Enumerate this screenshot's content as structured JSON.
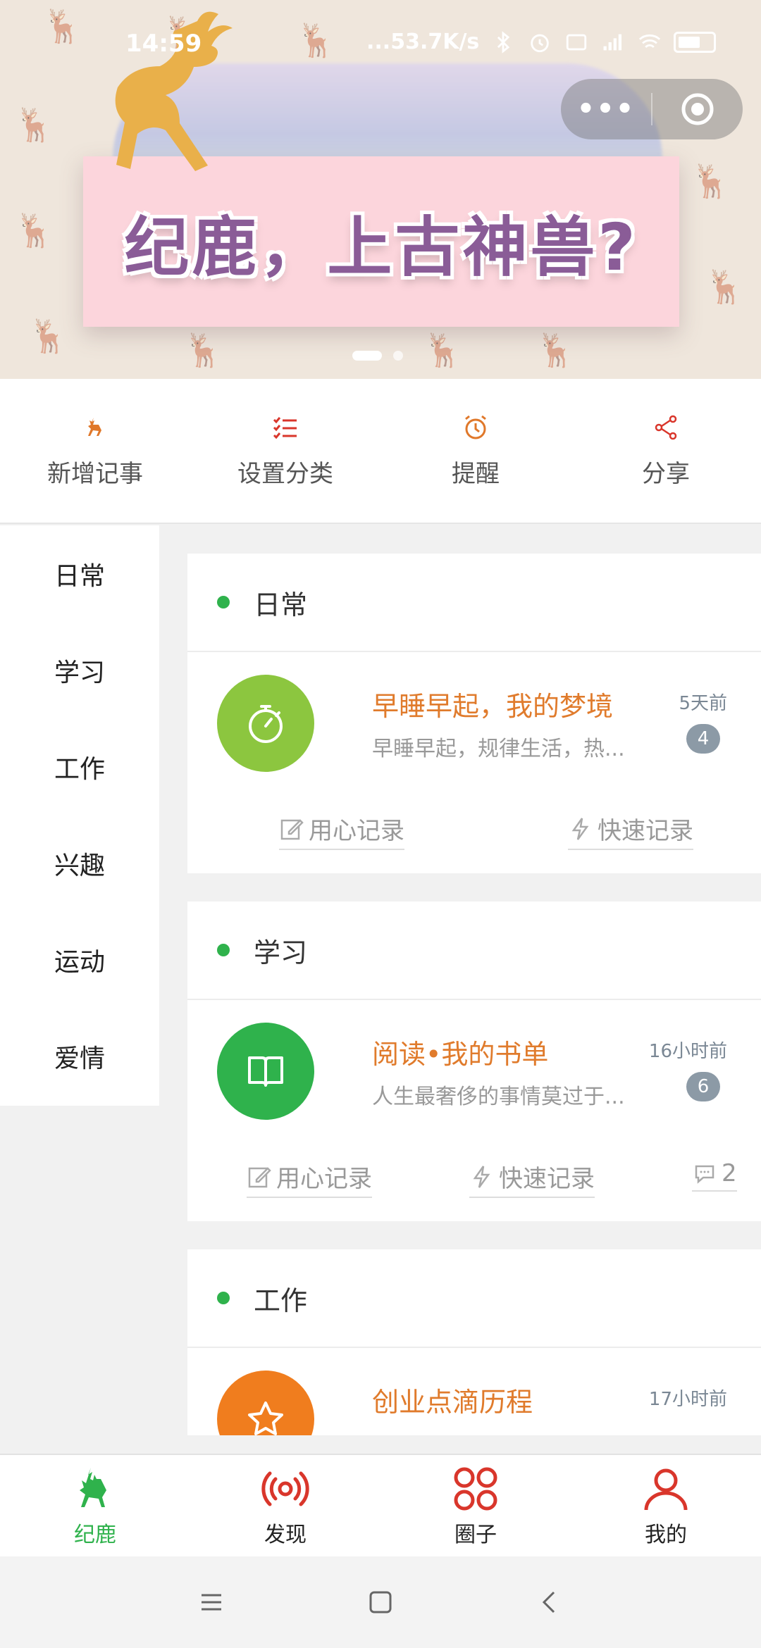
{
  "status_bar": {
    "time": "14:59",
    "speed": "...53.7K/s"
  },
  "banner": {
    "title": "纪鹿，上古神兽?"
  },
  "actions": [
    {
      "label": "新增记事",
      "icon": "deer-icon"
    },
    {
      "label": "设置分类",
      "icon": "checklist-icon"
    },
    {
      "label": "提醒",
      "icon": "alarm-icon"
    },
    {
      "label": "分享",
      "icon": "share-icon"
    }
  ],
  "sidebar": {
    "items": [
      "日常",
      "学习",
      "工作",
      "兴趣",
      "运动",
      "爱情"
    ]
  },
  "cards": [
    {
      "category": "日常",
      "title": "早睡早起，我的梦境",
      "desc": "早睡早起，规律生活，热...",
      "time": "5天前",
      "count": "4",
      "btn1": "用心记录",
      "btn2": "快速记录",
      "color": "#8cc63f"
    },
    {
      "category": "学习",
      "title": "阅读•我的书单",
      "desc": "人生最奢侈的事情莫过于...",
      "time": "16小时前",
      "count": "6",
      "btn1": "用心记录",
      "btn2": "快速记录",
      "comments": "2",
      "color": "#2fb24c"
    },
    {
      "category": "工作",
      "title": "创业点滴历程",
      "time": "17小时前",
      "color": "#f07d1e"
    }
  ],
  "tabbar": [
    {
      "label": "纪鹿",
      "icon": "deer-icon"
    },
    {
      "label": "发现",
      "icon": "broadcast-icon"
    },
    {
      "label": "圈子",
      "icon": "grid-icon"
    },
    {
      "label": "我的",
      "icon": "person-icon"
    }
  ],
  "colors": {
    "accent_green": "#2fb24c",
    "title_orange": "#e07b2c",
    "icon_red": "#d9362b"
  }
}
